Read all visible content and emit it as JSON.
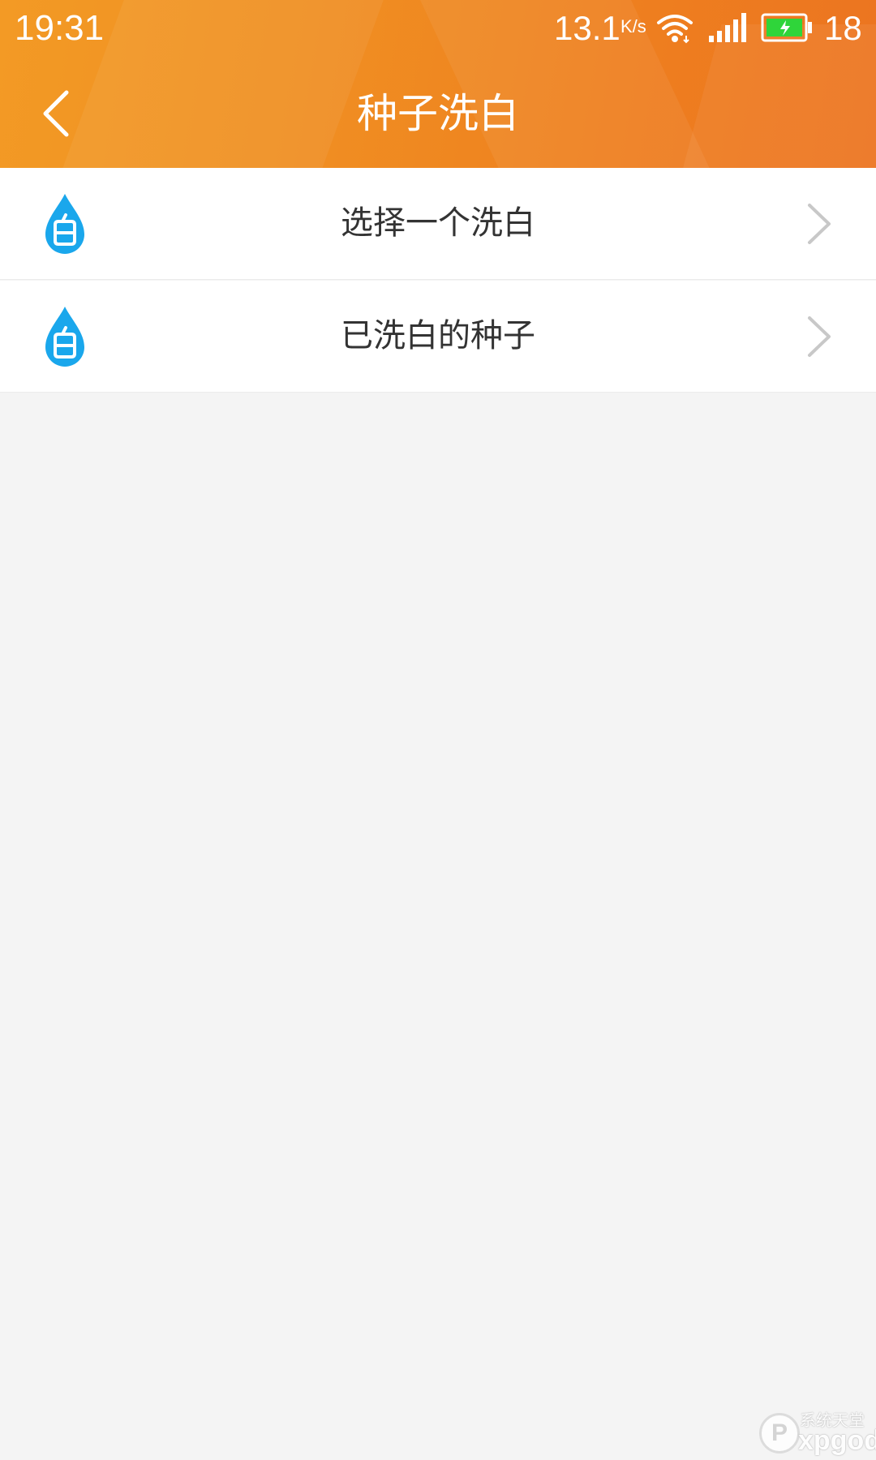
{
  "status_bar": {
    "time": "19:31",
    "network_speed": "13.1",
    "network_speed_unit": "K/s",
    "battery_level": "18"
  },
  "header": {
    "title": "种子洗白",
    "back_icon": "chevron-left-icon",
    "background_color": "#f08f22"
  },
  "menu": {
    "items": [
      {
        "label": "选择一个洗白",
        "icon": "water-drop-icon",
        "trailing_icon": "chevron-right-icon"
      },
      {
        "label": "已洗白的种子",
        "icon": "water-drop-icon",
        "trailing_icon": "chevron-right-icon"
      }
    ],
    "icon_color": "#1aa7ec"
  },
  "watermark": {
    "glyph": "P",
    "line1": "系统天堂",
    "line2": "xpgod"
  }
}
